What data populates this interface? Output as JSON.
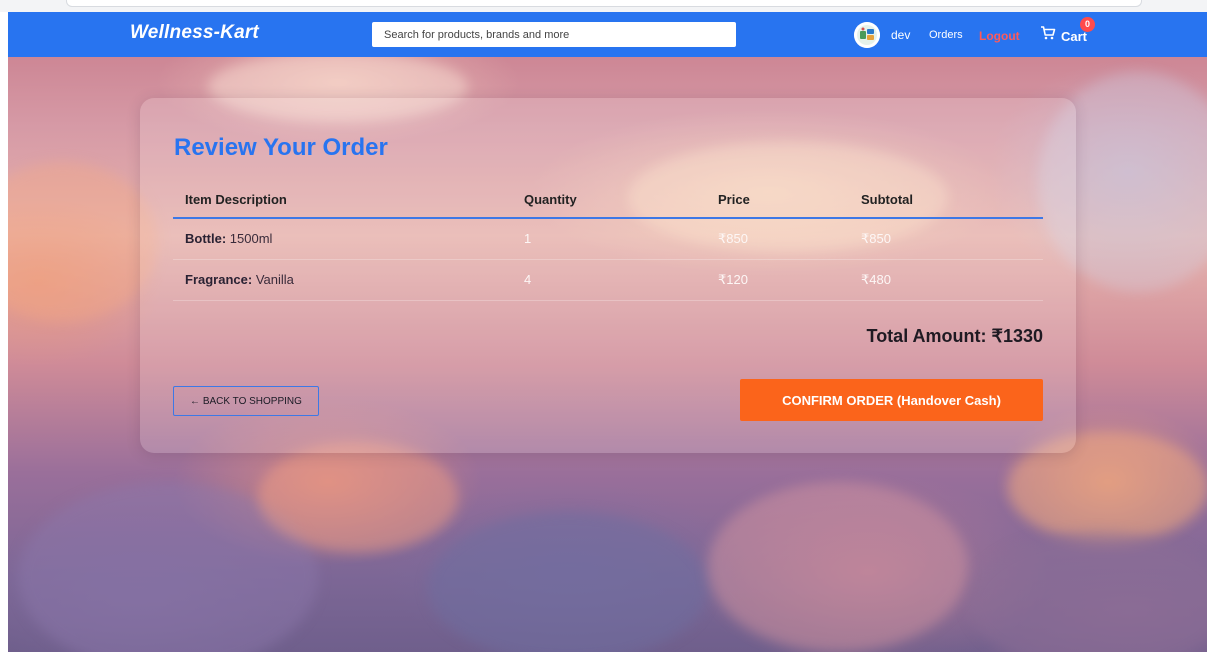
{
  "navbar": {
    "logo": "Wellness-Kart",
    "search_placeholder": "Search for products, brands and more",
    "user_name": "dev",
    "orders_label": "Orders",
    "logout_label": "Logout",
    "cart_label": "Cart",
    "cart_count": "0"
  },
  "review": {
    "title": "Review Your Order",
    "columns": [
      "Item Description",
      "Quantity",
      "Price",
      "Subtotal"
    ],
    "rows": [
      {
        "item_key": "Bottle:",
        "item_value": " 1500ml",
        "quantity": "1",
        "price": "₹850",
        "subtotal": "₹850"
      },
      {
        "item_key": "Fragrance:",
        "item_value": " Vanilla",
        "quantity": "4",
        "price": "₹120",
        "subtotal": "₹480"
      }
    ],
    "total_label": "Total Amount: ₹1330",
    "back_button": "← BACK TO SHOPPING",
    "confirm_button": "CONFIRM ORDER (Handover Cash)"
  },
  "colors": {
    "navbar": "#2874f0",
    "title": "#2874f0",
    "confirm": "#fb641b",
    "logout": "#ff5a5a",
    "badge": "#ff4b4b"
  },
  "icons": {
    "cart": "cart-icon",
    "avatar": "avatar-icon"
  }
}
